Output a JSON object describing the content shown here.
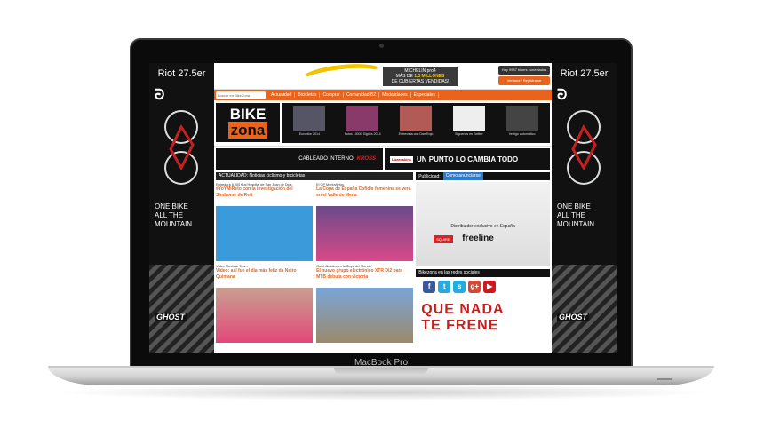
{
  "laptop": {
    "label": "MacBook Pro"
  },
  "side_ad": {
    "model": "Riot 27.5er",
    "tagline": [
      "ONE BIKE",
      "ALL THE",
      "MOUNTAIN"
    ],
    "brand": "GHOST"
  },
  "header": {
    "online_users": "Hay 9987 bikers conectados",
    "register_button": "Ventana / Registrarse",
    "tire_ad": {
      "brand": "MICHELIN pro4",
      "text1": "MÁS DE",
      "highlight": "1,5 MILLONES",
      "text2": "DE CUBIERTAS VENDIDAS!"
    }
  },
  "nav": {
    "search_placeholder": "Buscar en BikeZona",
    "items": [
      "Actualidad",
      "Bicicletas",
      "Comprar",
      "Comunidad BZ",
      "Modalidades",
      "Especiales"
    ]
  },
  "logo": {
    "line1": "BIKE",
    "line2": "zona"
  },
  "strip": {
    "items": [
      "Eurobike 2014",
      "Fotos 10000 Sigües 2014",
      "Entrevista con Dan Rojo",
      "Síguenos en Twitter",
      "Vertigo automático"
    ]
  },
  "banners": {
    "left_text": "CABLEADO INTERNO",
    "left_brand": "KROSS",
    "right_brand": "Lizardskins",
    "right_text": "UN PUNTO LO CAMBIA TODO"
  },
  "news": {
    "section_title": "ACTUALIDAD: Noticias ciclismo y bicicletas",
    "cards": [
      {
        "category": "Entregará 5,000 € al Hospital de San Juan de Dios",
        "title": "#YoYMiReto con la investigación del Síndrome de Rett"
      },
      {
        "category": "El GP Montañeros",
        "title": "La Copa de España Cofidis femenina se verá en el Valle de Mena"
      },
      {
        "category": "Vídeo Movistar Team",
        "title": "Vídeo: así fue el día más feliz de Nairo Quintana"
      },
      {
        "category": "Gasó Alcudes en la Copa del Mundo",
        "title": "El nuevo grupo electrónico XTR Di2 para MTB debuta con victoria"
      }
    ]
  },
  "sidebar": {
    "pub_label": "Publicidad:",
    "pub_cta": "Cómo anunciarse",
    "distributor_text": "Distribuidor exclusivo en España",
    "squire": "SQUIRE",
    "freeline": "freeline",
    "social_title": "Bikezona en las redes sociales",
    "social": [
      {
        "icon": "facebook-icon",
        "glyph": "f",
        "color": "#3b5998"
      },
      {
        "icon": "twitter-icon",
        "glyph": "t",
        "color": "#2aa9e0"
      },
      {
        "icon": "skype-icon",
        "glyph": "s",
        "color": "#1daee3"
      },
      {
        "icon": "googleplus-icon",
        "glyph": "g+",
        "color": "#d34836"
      },
      {
        "icon": "youtube-icon",
        "glyph": "▶",
        "color": "#cc181e"
      }
    ],
    "promo": [
      "QUE NADA",
      "TE FRENE"
    ]
  }
}
